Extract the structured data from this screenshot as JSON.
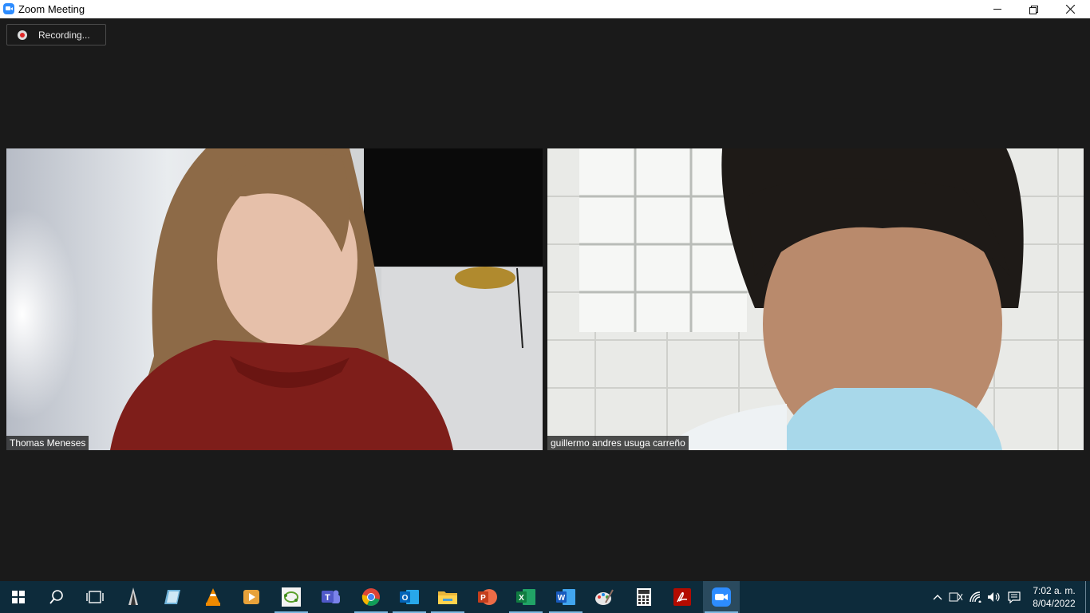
{
  "window": {
    "title": "Zoom Meeting",
    "icon": "zoom-icon",
    "controls": [
      "minimize",
      "restore",
      "close"
    ]
  },
  "recording": {
    "label": "Recording...",
    "icon": "recording-dot-icon",
    "color": "#e02828"
  },
  "participants": [
    {
      "name": "Thomas Meneses"
    },
    {
      "name": "guillermo andres usuga carreño"
    }
  ],
  "taskbar": {
    "apps": [
      {
        "name": "start",
        "icon": "windows-start-icon"
      },
      {
        "name": "search",
        "icon": "search-icon"
      },
      {
        "name": "task-view",
        "icon": "task-view-icon"
      },
      {
        "name": "app-1",
        "icon": "inkscape-icon"
      },
      {
        "name": "app-2",
        "icon": "notes-icon"
      },
      {
        "name": "vlc",
        "icon": "vlc-icon"
      },
      {
        "name": "media-player",
        "icon": "media-player-icon"
      },
      {
        "name": "geogebra",
        "icon": "geogebra-icon"
      },
      {
        "name": "teams",
        "icon": "teams-icon"
      },
      {
        "name": "chrome",
        "icon": "chrome-icon"
      },
      {
        "name": "outlook",
        "icon": "outlook-icon"
      },
      {
        "name": "file-explorer",
        "icon": "folder-icon"
      },
      {
        "name": "powerpoint",
        "icon": "powerpoint-icon"
      },
      {
        "name": "excel",
        "icon": "excel-icon"
      },
      {
        "name": "word",
        "icon": "word-icon"
      },
      {
        "name": "paint",
        "icon": "paint-icon"
      },
      {
        "name": "calculator",
        "icon": "calculator-icon"
      },
      {
        "name": "acrobat",
        "icon": "acrobat-icon"
      },
      {
        "name": "zoom",
        "icon": "zoom-icon"
      }
    ],
    "clock": {
      "time": "7:02 a. m.",
      "date": "8/04/2022"
    },
    "colors": {
      "background": "#0d2b3b",
      "zoom": "#2d8cff"
    }
  }
}
